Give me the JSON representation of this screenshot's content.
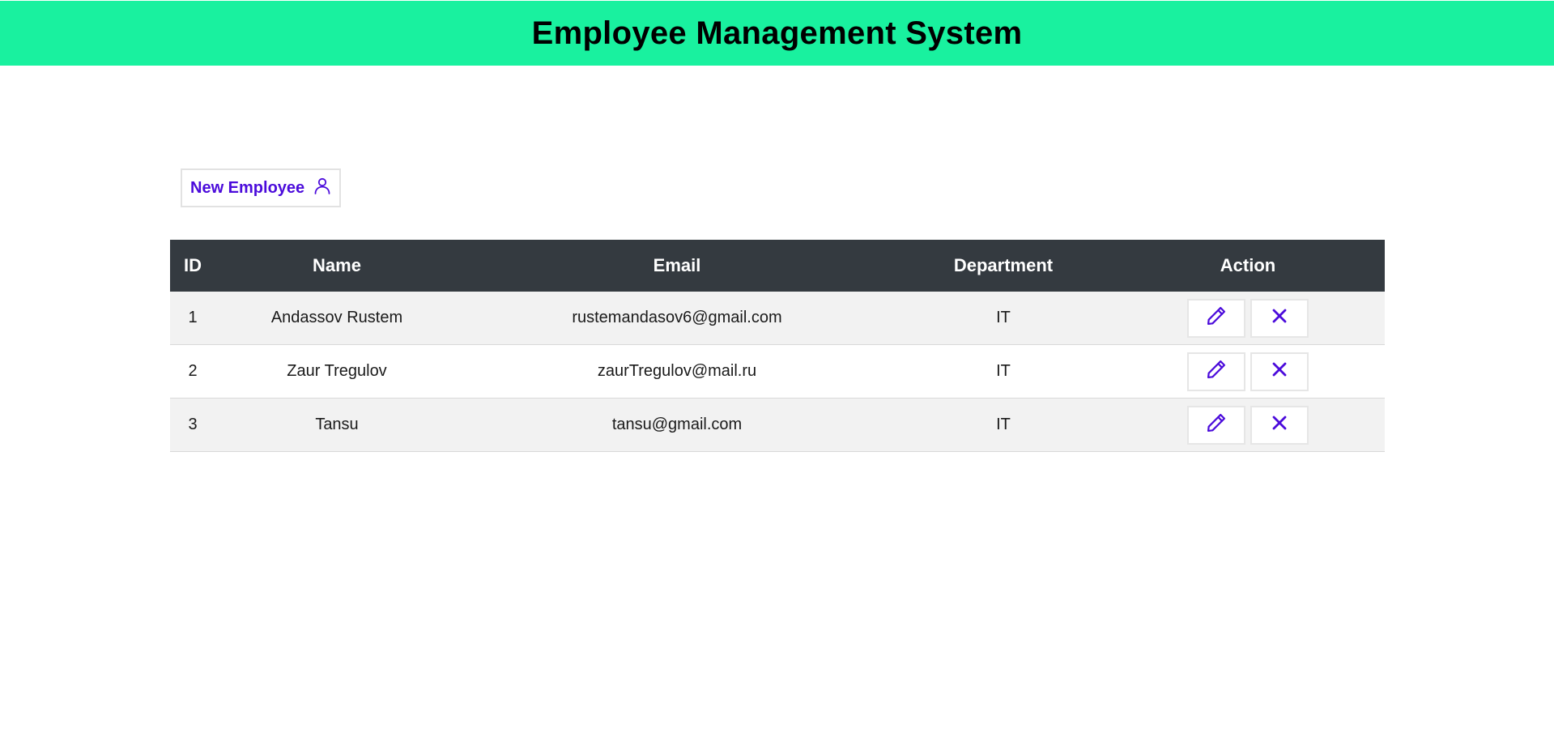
{
  "header": {
    "title": "Employee Management System"
  },
  "toolbar": {
    "new_employee_label": "New Employee",
    "new_employee_icon": "user-icon"
  },
  "table": {
    "columns": [
      "ID",
      "Name",
      "Email",
      "Department",
      "Action"
    ],
    "rows": [
      {
        "id": "1",
        "name": "Andassov Rustem",
        "email": "rustemandasov6@gmail.com",
        "department": "IT"
      },
      {
        "id": "2",
        "name": "Zaur Tregulov",
        "email": "zaurTregulov@mail.ru",
        "department": "IT"
      },
      {
        "id": "3",
        "name": "Tansu",
        "email": "tansu@gmail.com",
        "department": "IT"
      }
    ],
    "row_actions": {
      "edit_icon": "pencil-icon",
      "delete_icon": "close-icon"
    }
  },
  "colors": {
    "header_bg": "#19f19f",
    "table_header_bg": "#343a40",
    "accent": "#4b0bdb",
    "row_alt_bg": "#f2f2f2"
  }
}
